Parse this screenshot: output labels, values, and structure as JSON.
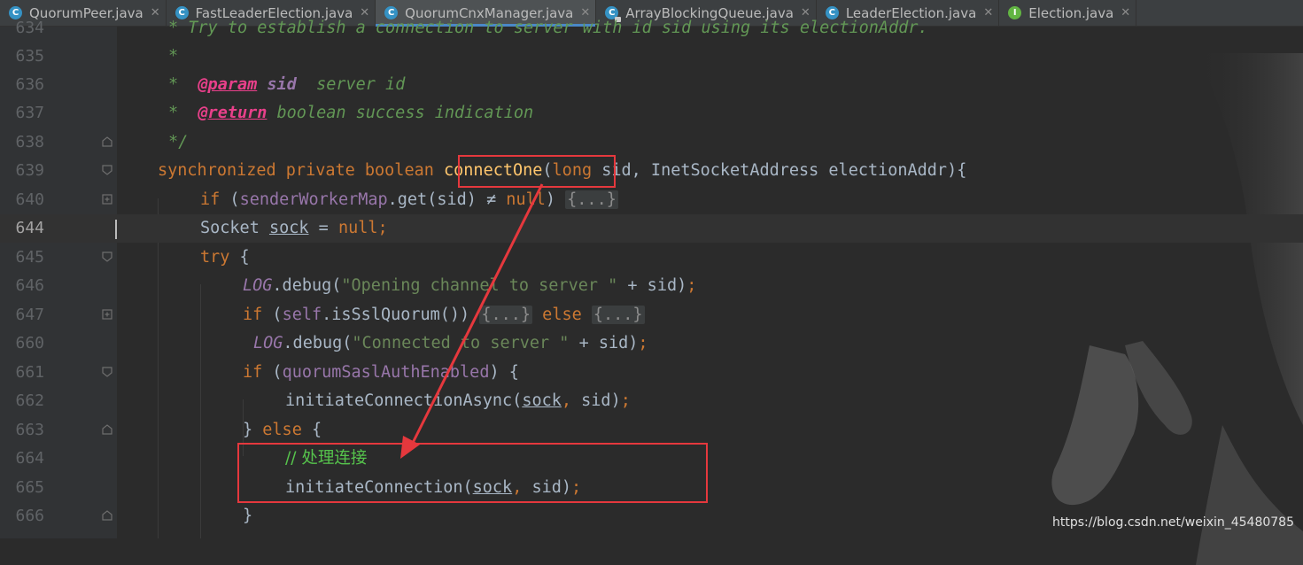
{
  "tabs": [
    {
      "label": "QuorumPeer.java",
      "icon": "class",
      "active": false
    },
    {
      "label": "FastLeaderElection.java",
      "icon": "class",
      "active": false
    },
    {
      "label": "QuorumCnxManager.java",
      "icon": "class",
      "active": true
    },
    {
      "label": "ArrayBlockingQueue.java",
      "icon": "class-locked",
      "active": false
    },
    {
      "label": "LeaderElection.java",
      "icon": "class",
      "active": false
    },
    {
      "label": "Election.java",
      "icon": "interface",
      "active": false
    }
  ],
  "tab_icon_letters": {
    "class": "C",
    "interface": "I"
  },
  "line_numbers": [
    "634",
    "635",
    "636",
    "637",
    "638",
    "639",
    "640",
    "644",
    "645",
    "646",
    "647",
    "660",
    "661",
    "662",
    "663",
    "664",
    "665",
    "666"
  ],
  "current_line": "644",
  "code": {
    "l634": "* Try to establish a connection to server with id sid using its electionAddr.",
    "l635_star": "*",
    "l636_star": "*",
    "l636_tag": "@param",
    "l636_name": "sid",
    "l636_desc": "server id",
    "l637_star": "*",
    "l637_tag": "@return",
    "l637_desc": "boolean success indication",
    "l638": "*/",
    "l639_mods": "synchronized private boolean ",
    "l639_method": "connectOne",
    "l639_open": "(",
    "l639_long": "long",
    "l639_rest": " sid, InetSocketAddress electionAddr){",
    "l640_if": "if",
    "l640_a": " (",
    "l640_field": "senderWorkerMap",
    "l640_b": ".get(sid) ",
    "l640_ne": "≠",
    "l640_null": " null",
    "l640_c": ") ",
    "l640_fold": "{...}",
    "l644_type": "Socket ",
    "l644_var": "sock",
    "l644_eq": " = ",
    "l644_null": "null",
    "l644_semi": ";",
    "l645_try": "try",
    "l645_brace": " {",
    "l646_log": "LOG",
    "l646_call": ".debug(",
    "l646_str": "\"Opening channel to server \"",
    "l646_rest": " + sid)",
    "l646_semi": ";",
    "l647_if": "if",
    "l647_a": " (",
    "l647_self": "self",
    "l647_b": ".isSslQuorum()) ",
    "l647_fold1": "{...}",
    "l647_else": " else ",
    "l647_fold2": "{...}",
    "l660_log": "LOG",
    "l660_call": ".debug(",
    "l660_str": "\"Connected to server \"",
    "l660_rest": " + sid)",
    "l660_semi": ";",
    "l661_if": "if",
    "l661_a": " (",
    "l661_field": "quorumSaslAuthEnabled",
    "l661_b": ") {",
    "l662_call": "initiateConnectionAsync(",
    "l662_var": "sock",
    "l662_comma": ",",
    "l662_rest": " sid)",
    "l662_semi": ";",
    "l663_close": "} ",
    "l663_else": "else",
    "l663_brace": " {",
    "l664_comment": "// 处理连接",
    "l665_call": "initiateConnection(",
    "l665_var": "sock",
    "l665_comma": ",",
    "l665_rest": " sid)",
    "l665_semi": ";",
    "l666": "}"
  },
  "watermark": "https://blog.csdn.net/weixin_45480785",
  "colors": {
    "background": "#2b2b2b",
    "gutter": "#313335",
    "keyword": "#cc7832",
    "method": "#ffc66d",
    "string": "#6a8759",
    "field": "#9876aa",
    "doc_comment": "#629755",
    "annotation_red": "#e5383d"
  }
}
